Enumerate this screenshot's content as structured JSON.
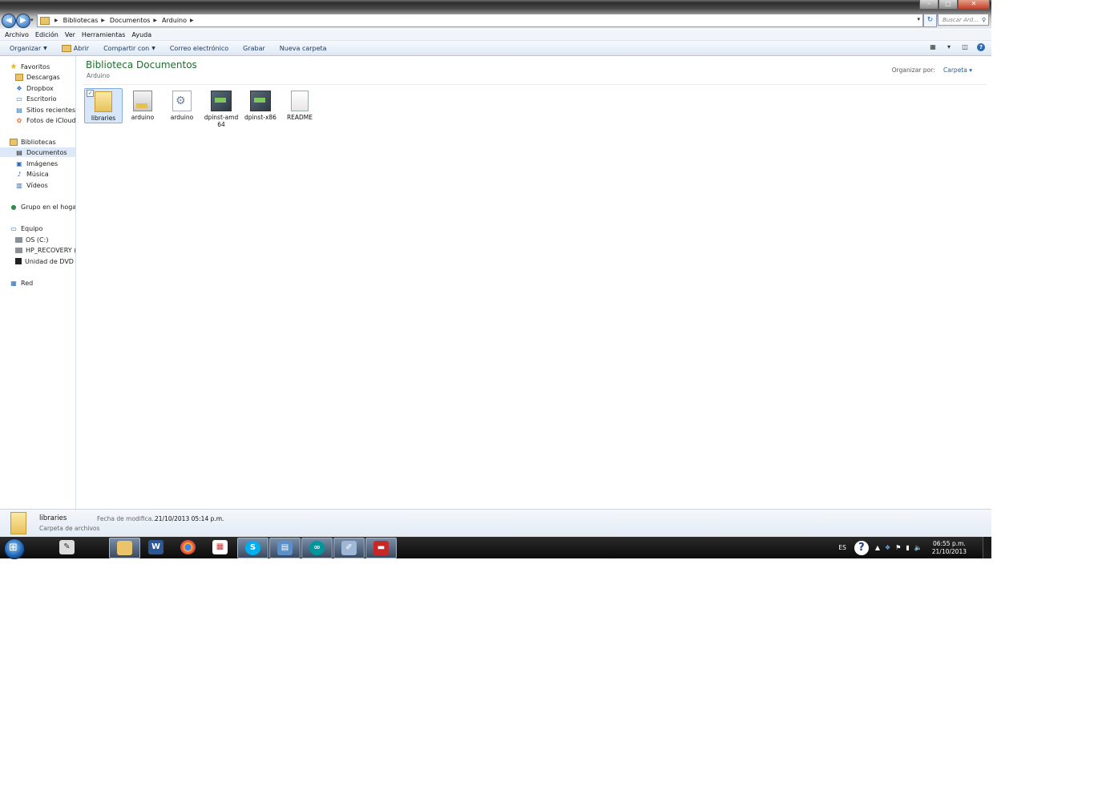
{
  "address": {
    "crumbs": [
      "Bibliotecas",
      "Documentos",
      "Arduino"
    ],
    "search_placeholder": "Buscar Ard..."
  },
  "window_controls": {
    "minimize": "–",
    "maximize": "□",
    "close": "✕"
  },
  "menu": [
    "Archivo",
    "Edición",
    "Ver",
    "Herramientas",
    "Ayuda"
  ],
  "commands": {
    "organize": "Organizar",
    "open": "Abrir",
    "share": "Compartir con",
    "email": "Correo electrónico",
    "burn": "Grabar",
    "new_folder": "Nueva carpeta"
  },
  "sidebar": {
    "favorites": "Favoritos",
    "favorites_items": [
      "Descargas",
      "Dropbox",
      "Escritorio",
      "Sitios recientes",
      "Fotos de iCloud"
    ],
    "libraries": "Bibliotecas",
    "libraries_items": [
      "Documentos",
      "Imágenes",
      "Música",
      "Vídeos"
    ],
    "homegroup": "Grupo en el hogar",
    "computer": "Equipo",
    "computer_items": [
      "OS (C:)",
      "HP_RECOVERY (D:",
      "Unidad de DVD RV"
    ],
    "network": "Red"
  },
  "content": {
    "title": "Biblioteca Documentos",
    "subtitle": "Arduino",
    "arrange_label": "Organizar por:",
    "arrange_value": "Carpeta",
    "files": [
      {
        "name": "libraries",
        "icon": "folder-icon"
      },
      {
        "name": "arduino",
        "icon": "printer-app-icon"
      },
      {
        "name": "arduino",
        "icon": "settings-file-icon"
      },
      {
        "name": "dpinst-amd\n64",
        "icon": "installer-icon"
      },
      {
        "name": "dpinst-x86",
        "icon": "installer-icon"
      },
      {
        "name": "README",
        "icon": "text-file-icon"
      }
    ]
  },
  "details": {
    "name": "libraries",
    "type": "Carpeta de archivos",
    "modified_label": "Fecha de modifica...",
    "modified_value": "21/10/2013 05:14 p.m."
  },
  "taskbar": {
    "language": "ES",
    "time": "06:55 p.m.",
    "date": "21/10/2013"
  }
}
